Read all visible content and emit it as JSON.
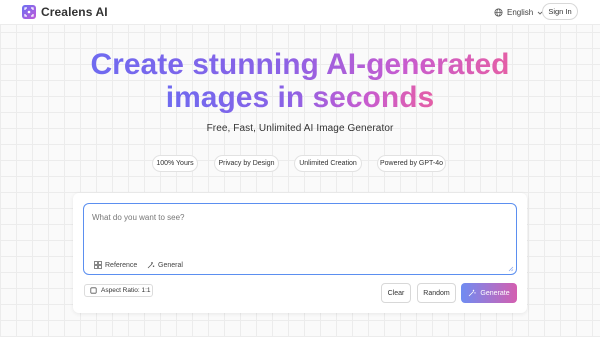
{
  "header": {
    "brand": "Crealens AI",
    "language": "English",
    "sign_in": "Sign In"
  },
  "hero": {
    "title_line1": "Create stunning AI-generated",
    "title_line2": "images in seconds",
    "subtitle": "Free, Fast, Unlimited AI Image Generator"
  },
  "badges": [
    "100% Yours",
    "Privacy by Design",
    "Unlimited Creation",
    "Powered by GPT-4o"
  ],
  "prompt": {
    "placeholder": "What do you want to see?",
    "reference_label": "Reference",
    "style_label": "General"
  },
  "controls": {
    "aspect_ratio": "Aspect Ratio: 1:1",
    "clear": "Clear",
    "random": "Random",
    "generate": "Generate"
  },
  "colors": {
    "accent_blue": "#6f8cf2",
    "accent_pink": "#d45fb0",
    "focus_border": "#5b8ff0"
  },
  "icons": {
    "logo": "frame-icon",
    "language": "globe-icon",
    "reference": "image-icon",
    "style": "sparkle-icon",
    "aspect": "square-icon",
    "generate": "magic-wand-icon"
  }
}
